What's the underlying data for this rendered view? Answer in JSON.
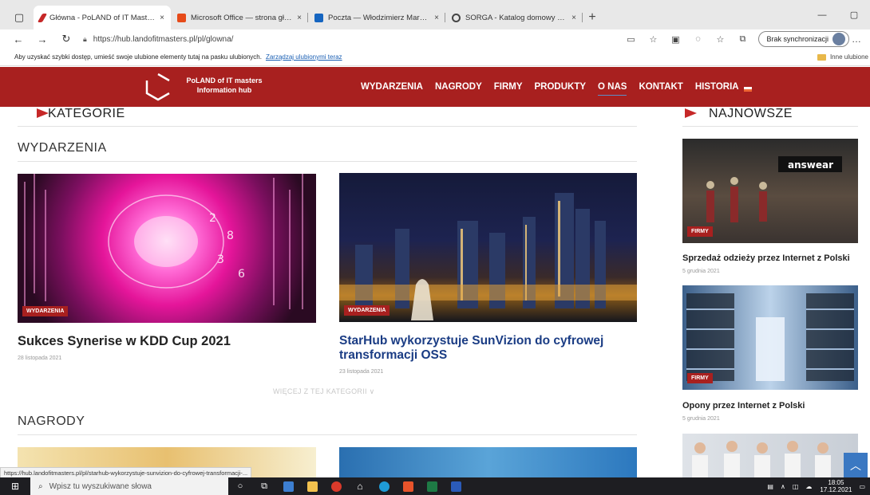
{
  "browser": {
    "tabs": [
      {
        "title": "Główna - PoLAND of IT Masters",
        "close": "×",
        "favicon": "red-pen-icon",
        "color": "#c62828"
      },
      {
        "title": "Microsoft Office — strona główn",
        "close": "×",
        "favicon": "office-icon",
        "color": "#e64a19"
      },
      {
        "title": "Poczta — Włodzimierz Marciński",
        "close": "×",
        "favicon": "mail-icon",
        "color": "#1565c0"
      },
      {
        "title": "SORGA - Katalog domowy - ...",
        "close": "×",
        "favicon": "circle-icon",
        "color": "#444444"
      }
    ],
    "new_tab": "+",
    "url": "https://hub.landofitmasters.pl/pl/glowna/",
    "sync_label": "Brak synchronizacji",
    "favorites_text": "Aby uzyskać szybki dostęp, umieść swoje ulubione elementy tutaj na pasku ulubionych.",
    "favorites_link": "Zarządzaj ulubionymi teraz",
    "other_favorites": "Inne ulubione"
  },
  "site": {
    "brand_line1": "PoLAND of IT masters",
    "brand_line2": "Information hub",
    "menu": [
      "WYDARZENIA",
      "NAGRODY",
      "FIRMY",
      "PRODUKTY",
      "O NAS",
      "KONTAKT",
      "HISTORIA"
    ],
    "accent": "#a8201f"
  },
  "main": {
    "categories_heading": "KATEGORIE",
    "newest_heading": "NAJNOWSZE",
    "section1": "WYDARZENIA",
    "section2": "NAGRODY",
    "articles": [
      {
        "badge": "WYDARZENIA",
        "title": "Sukces Synerise w KDD Cup 2021",
        "date": "28 listopada 2021"
      },
      {
        "badge": "WYDARZENIA",
        "title": "StarHub wykorzystuje SunVizion do cyfrowej transformacji OSS",
        "date": "23 listopada 2021"
      }
    ],
    "more_link": "WIĘCEJ Z TEJ KATEGORII ∨",
    "sidebar": [
      {
        "badge": "FIRMY",
        "title": "Sprzedaż odzieży przez Internet z Polski",
        "date": "5 grudnia 2021"
      },
      {
        "badge": "FIRMY",
        "title": "Opony przez Internet z Polski",
        "date": "5 grudnia 2021"
      }
    ]
  },
  "status_url": "https://hub.landofitmasters.pl/pl/starhub-wykorzystuje-sunvizion-do-cyfrowej-transformacji-...",
  "taskbar": {
    "search_placeholder": "Wpisz tu wyszukiwane słowa",
    "time": "18:05",
    "date": "17.12.2021"
  }
}
